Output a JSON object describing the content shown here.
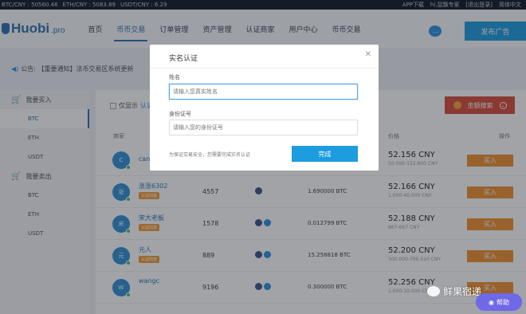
{
  "topstrip": {
    "rates": [
      "BTC/CNY : 50560.46",
      "ETH/CNY : 5083.89",
      "USDT/CNY : 6.29"
    ],
    "app_download": "APP下载",
    "user": "hi,鼠飘专家",
    "logout": "[退出登录]",
    "language": "简体中文"
  },
  "header": {
    "logo_text": "Huobi",
    "logo_suffix": ".pro",
    "nav": [
      "首页",
      "币币交易",
      "订单管理",
      "资产管理",
      "认证商家",
      "用户中心",
      "币币交易"
    ],
    "active_nav_index": 1,
    "chat_icon": "chat-bubble-icon",
    "publish_label": "发布广告"
  },
  "notice": {
    "text": "公告: 【重要通知】法币交易区系统更新"
  },
  "sidebar": {
    "buy_header": "我要买入",
    "buy_items": [
      "BTC",
      "ETH",
      "USDT"
    ],
    "sell_header": "我要卖出",
    "sell_items": [
      "BTC",
      "ETH",
      "USDT"
    ],
    "active": "BTC"
  },
  "main": {
    "filter_label": "仅显示",
    "filter_link": "认证",
    "search_label": "金额搜索",
    "columns": {
      "merchant": "商家",
      "price": "价格",
      "action": "操作"
    },
    "rows": [
      {
        "avatar": "C",
        "name": "can",
        "badge": "",
        "count": "",
        "amount": "",
        "price": "52.156 CNY",
        "limit": "50.000-152.800 CNY",
        "action": "买入",
        "pay": 0
      },
      {
        "avatar": "涨",
        "name": "涨涨6302",
        "badge": "认证商家",
        "count": "4557",
        "amount": "1.690000 BTC",
        "price": "52.166 CNY",
        "limit": "1.000-40.000 CNY",
        "action": "买入",
        "pay": 1
      },
      {
        "avatar": "宋",
        "name": "宋大老板",
        "badge": "认证商家",
        "count": "1578",
        "amount": "0.012799 BTC",
        "price": "52.188 CNY",
        "limit": "667-667 CNY",
        "action": "买入",
        "pay": 2
      },
      {
        "avatar": "元",
        "name": "元人",
        "badge": "认证商家",
        "count": "889",
        "amount": "15.258818 BTC",
        "price": "52.200 CNY",
        "limit": "100.000-796.510 CNY",
        "action": "买入",
        "pay": 2
      },
      {
        "avatar": "W",
        "name": "wangc",
        "badge": "",
        "count": "9196",
        "amount": "0.300000 BTC",
        "price": "52.256 CNY",
        "limit": "1.000-10.000 CNY",
        "action": "买入",
        "pay": 2
      }
    ]
  },
  "modal": {
    "title": "实名认证",
    "name_label": "姓名",
    "name_placeholder": "请输入您真实姓名",
    "id_label": "身份证号",
    "id_placeholder": "请输入您的身份证号",
    "hint": "为保证交易安全，您需要完成实名认证",
    "done_label": "完成",
    "close_icon": "close-icon"
  },
  "watermark": {
    "text": "鲜果宿递"
  },
  "help": {
    "label": "帮助",
    "icon": "chat-icon"
  }
}
